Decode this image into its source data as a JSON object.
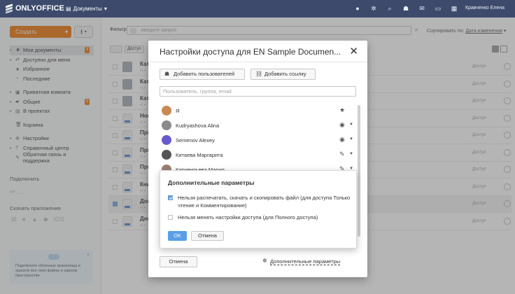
{
  "topbar": {
    "logo": "ONLYOFFICE",
    "module": "Документы",
    "user": "Кравченко Елена",
    "icons": [
      "help-icon",
      "settings-icon",
      "search-icon",
      "people-icon",
      "mail-icon",
      "chat-icon",
      "calendar-icon"
    ]
  },
  "sidebar": {
    "create": "Создать",
    "items": [
      {
        "label": "Мои документы",
        "badge": "4"
      },
      {
        "label": "Доступно для меня"
      },
      {
        "label": "Избранное"
      },
      {
        "label": "Последние"
      },
      {
        "label": "Приватная комната"
      },
      {
        "label": "Общие",
        "badge": "6"
      },
      {
        "label": "В проектах"
      },
      {
        "label": "Корзина"
      },
      {
        "label": "Настройки"
      },
      {
        "label": "Справочный центр"
      },
      {
        "label": "Обратная связь и поддержка"
      }
    ],
    "connect": "Подключить",
    "download_apps": "Скачать приложения",
    "promo": "Подключите облачные хранилища и храните все свои файлы в едином пространстве"
  },
  "main": {
    "filter_label": "Фильтр",
    "filter_placeholder": "введите запрос",
    "sort_label": "Сортировать по:",
    "sort_value": "Дата изменения",
    "toolbar_access": "Доступ",
    "rows": [
      {
        "title": "Кат",
        "type": "folder"
      },
      {
        "title": "Кат",
        "type": "folder"
      },
      {
        "title": "Кат",
        "type": "folder"
      },
      {
        "title": "Нов",
        "type": "doc"
      },
      {
        "title": "При",
        "type": "doc"
      },
      {
        "title": "При",
        "type": "doc"
      },
      {
        "title": "При",
        "type": "doc"
      },
      {
        "title": "Кни",
        "type": "doc"
      },
      {
        "title": "Док",
        "type": "doc",
        "checked": true
      },
      {
        "title": "Дес",
        "type": "doc"
      }
    ],
    "row_access": "Доступ"
  },
  "dialog": {
    "title": "Настройки доступа для EN Sample Documen...",
    "add_users": "Добавить пользователей",
    "add_link": "Добавить ссылку",
    "user_placeholder": "Пользователь, группа, email",
    "users": [
      {
        "name": "Я",
        "right": "owner-star-icon",
        "color": "#c88a50"
      },
      {
        "name": "Kudryashova Alina",
        "right": "eye-icon",
        "color": "#8a8a8a"
      },
      {
        "name": "Semenov Alexey",
        "right": "eye-icon",
        "color": "#6a5acd"
      },
      {
        "name": "Китаева Маргарита",
        "right": "pencil-icon",
        "color": "#555555"
      },
      {
        "name": "Кириентьева Мария",
        "right": "pencil-icon",
        "color": "#9a8070"
      }
    ],
    "cancel": "Отмена",
    "advanced": "Дополнительные параметры"
  },
  "popup": {
    "title": "Дополнительные параметры",
    "option1": "Нельзя распечатать, скачать и скопировать файл (для доступа Только чтение и Комментирование)",
    "option1_checked": true,
    "option2": "Нельзя менять настройки доступа (для Полного доступа)",
    "option2_checked": false,
    "ok": "OK",
    "cancel": "Отмена"
  }
}
